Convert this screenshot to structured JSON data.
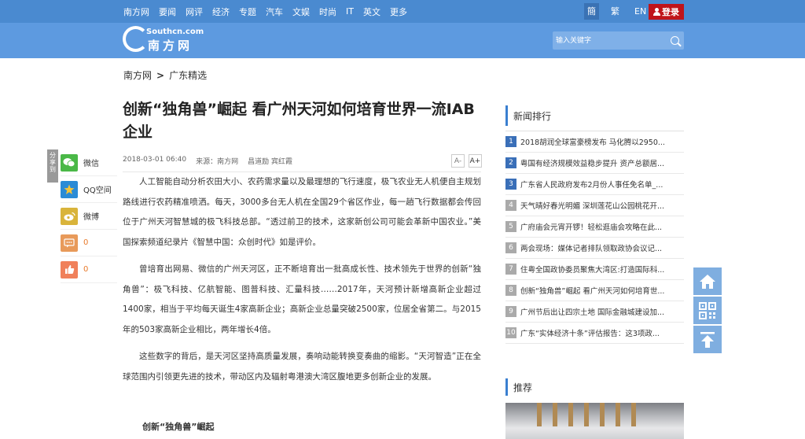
{
  "topnav": {
    "links": [
      "南方网",
      "要闻",
      "网评",
      "经济",
      "专题",
      "汽车",
      "文娱",
      "时尚",
      "IT",
      "英文",
      "更多"
    ],
    "languages": [
      "簡",
      "繁",
      "EN"
    ],
    "active_language": "簡",
    "login_label": "登录"
  },
  "header": {
    "logo_domain": "Southcn.com",
    "logo_name": "南方网",
    "search_placeholder": "输入关键字"
  },
  "breadcrumb": {
    "home": "南方网",
    "separator": ">",
    "section": "广东精选"
  },
  "article": {
    "title": "创新“独角兽”崛起 看广州天河如何培育世界一流IAB企业",
    "date": "2018-03-01 06:40",
    "source": "来源：南方网",
    "authors": "昌道励 宾红霞",
    "font_decrease": "A-",
    "font_increase": "A+",
    "paragraphs": [
      "人工智能自动分析农田大小、农药需求量以及最理想的飞行速度，极飞农业无人机便自主规划路线进行农药精准喷洒。每天，3000多台无人机在全国29个省区作业，每一趟飞行数据都会传回位于广州天河智慧城的极飞科技总部。“透过前卫的技术，这家新创公司可能会革新中国农业。”美国探索频道纪录片《智慧中国：众创时代》如是评价。",
      "曾培育出网易、微信的广州天河区，正不断培育出一批高成长性、技术领先于世界的创新“独角兽”：极飞科技、亿航智能、图普科技、汇量科技……2017年，天河预计新增高新企业超过1400家，相当于平均每天诞生4家高新企业；高新企业总量突破2500家，位居全省第二。与2015年的503家高新企业相比，两年增长4倍。",
      "这些数字的背后，是天河区坚持高质量发展，奏响动能转换变奏曲的缩影。“天河智造”正在全球范围内引领更先进的技术，带动区内及辐射粤港澳大湾区腹地更多创新企业的发展。"
    ],
    "subheading": "创新“独角兽”崛起"
  },
  "share": {
    "tab_label": "分享到",
    "items": [
      {
        "label": "微信",
        "icon": "wechat-icon"
      },
      {
        "label": "QQ空间",
        "icon": "qzone-icon"
      },
      {
        "label": "微博",
        "icon": "weibo-icon"
      }
    ],
    "comment_count": "0",
    "like_count": "0"
  },
  "sidebar": {
    "ranking_title": "新闻排行",
    "ranking": [
      {
        "num": "1",
        "text": "2018胡润全球富豪榜发布 马化腾以2950..."
      },
      {
        "num": "2",
        "text": "粤国有经济规模效益稳步提升 资产总额居..."
      },
      {
        "num": "3",
        "text": "广东省人民政府发布2月份人事任免名单_..."
      },
      {
        "num": "4",
        "text": "天气晴好春光明媚 深圳莲花山公园桃花开..."
      },
      {
        "num": "5",
        "text": "广府庙会元宵开锣！轻松逛庙会攻略在此..."
      },
      {
        "num": "6",
        "text": "两会现场：媒体记者排队领取政协会议记..."
      },
      {
        "num": "7",
        "text": "住粤全国政协委员聚焦大湾区:打造国际科..."
      },
      {
        "num": "8",
        "text": "创新“独角兽”崛起 看广州天河如何培育世..."
      },
      {
        "num": "9",
        "text": "广州节后出让四宗土地 国际金融城建设加..."
      },
      {
        "num": "10",
        "text": "广东“实体经济十条”评估报告：这3项政..."
      }
    ],
    "recommend_title": "推荐"
  },
  "float_tools": [
    "home-icon",
    "qrcode-icon",
    "back-to-top-icon"
  ],
  "colors": {
    "topnav_bg": "#4a8ad0",
    "header_bg": "#5d9ae0",
    "login_bg": "#c0141a",
    "rank_top_bg": "#3a6fb8",
    "accent": "#3a7fd0"
  }
}
